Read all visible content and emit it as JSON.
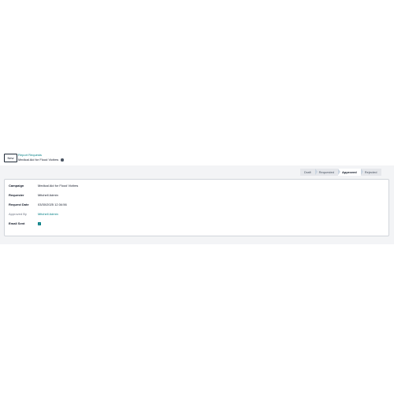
{
  "control_panel": {
    "new_label": "New",
    "breadcrumb_parent": "Report Requests",
    "breadcrumb_current": "Medical Aid for Flood Victims"
  },
  "statusbar": {
    "steps": [
      "Draft",
      "Requested",
      "Approved",
      "Rejected"
    ],
    "active": "Approved"
  },
  "form": {
    "campaign_label": "Campaign",
    "campaign_value": "Medical Aid for Flood Victims",
    "requester_label": "Requester",
    "requester_value": "Mitchell Admin",
    "request_date_label": "Request Date",
    "request_date_value": "03/30/2025 12:34:56",
    "approved_by_label": "Approved By",
    "approved_by_value": "Mitchell Admin",
    "email_sent_label": "Email Sent",
    "email_sent_checked": true
  },
  "colors": {
    "accent": "#017e84"
  },
  "icons": {
    "info": "info-icon",
    "check": "check-icon"
  }
}
